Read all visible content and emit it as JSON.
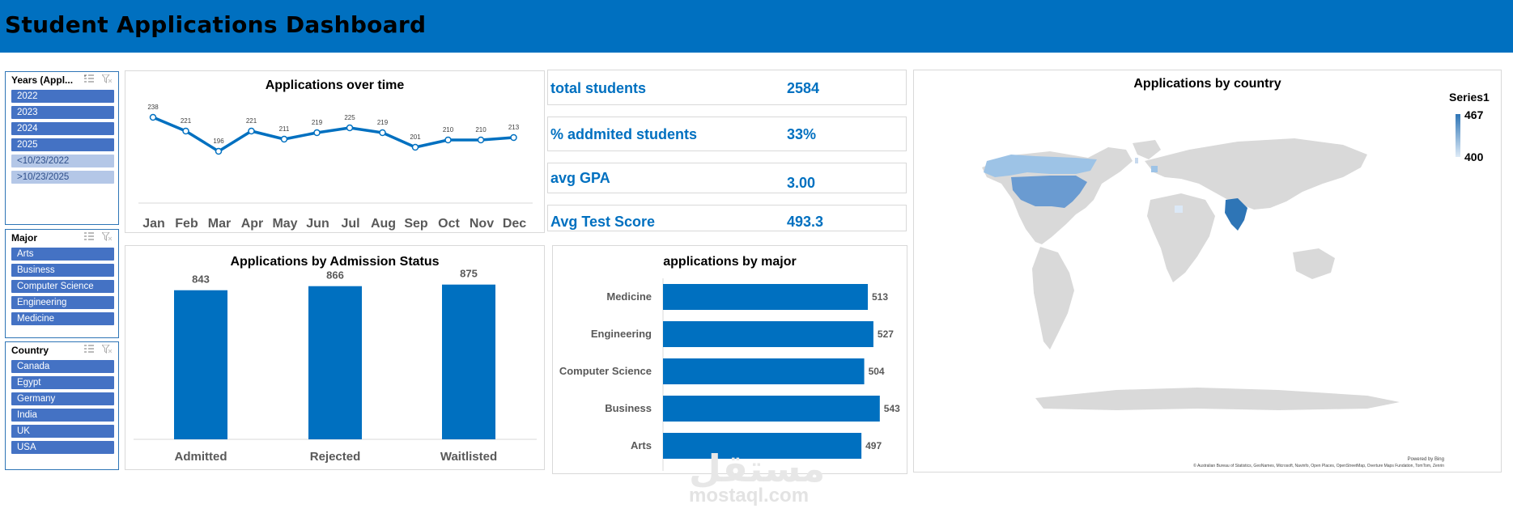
{
  "header": {
    "title": "Student Applications Dashboard"
  },
  "colors": {
    "header": "#0070c0",
    "bar": "#0070c0",
    "slicer_selected": "#4472c4",
    "slicer_unselected": "#b4c7e7",
    "kpi": "#0070c0"
  },
  "icons": {
    "multi_select": "multi-select-icon",
    "clear_filter": "clear-filter-icon"
  },
  "slicers": {
    "years": {
      "title": "Years (Appl...",
      "items": [
        "2022",
        "2023",
        "2024",
        "2025",
        "<10/23/2022",
        ">10/23/2025"
      ]
    },
    "major": {
      "title": "Major",
      "items": [
        "Arts",
        "Business",
        "Computer Science",
        "Engineering",
        "Medicine"
      ]
    },
    "country": {
      "title": "Country",
      "items": [
        "Canada",
        "Egypt",
        "Germany",
        "India",
        "UK",
        "USA"
      ]
    }
  },
  "kpis": {
    "total_students": {
      "label": "total students",
      "value": "2584"
    },
    "admitted": {
      "label": "% addmited students",
      "value": "33%"
    },
    "gpa": {
      "label": "avg GPA",
      "value": "3.00"
    },
    "test": {
      "label": "Avg Test Score",
      "value": "493.3"
    }
  },
  "map": {
    "title": "Applications by country",
    "legend_title": "Series1",
    "legend_max": "467",
    "legend_min": "400",
    "powered_by": "Powered by Bing",
    "credits": "© Australian Bureau of Statistics, GeoNames, Microsoft, Navinfo, Open Places, OpenStreetMap, Overture Maps Fundation, TomTom, Zenrin"
  },
  "watermark": {
    "logo_text": "مستقل",
    "site": "mostaql.com"
  },
  "chart_data": [
    {
      "type": "line",
      "title": "Applications over time",
      "categories": [
        "Jan",
        "Feb",
        "Mar",
        "Apr",
        "May",
        "Jun",
        "Jul",
        "Aug",
        "Sep",
        "Oct",
        "Nov",
        "Dec"
      ],
      "values": [
        238,
        221,
        196,
        221,
        211,
        219,
        225,
        219,
        201,
        210,
        210,
        213
      ]
    },
    {
      "type": "bar",
      "title": "Applications by Admission Status",
      "categories": [
        "Admitted",
        "Rejected",
        "Waitlisted"
      ],
      "values": [
        843,
        866,
        875
      ]
    },
    {
      "type": "bar",
      "orientation": "horizontal",
      "title": "applications by major",
      "categories": [
        "Medicine",
        "Engineering",
        "Computer Science",
        "Business",
        "Arts"
      ],
      "values": [
        513,
        527,
        504,
        543,
        497
      ]
    }
  ]
}
